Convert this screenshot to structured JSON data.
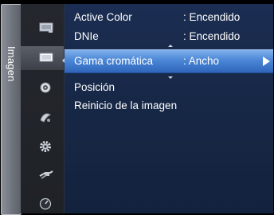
{
  "sidebar": {
    "title": "Imagen",
    "icons": [
      {
        "name": "picture-settings-icon",
        "active": false
      },
      {
        "name": "picture-icon",
        "active": true
      },
      {
        "name": "sound-icon",
        "active": false
      },
      {
        "name": "channel-icon",
        "active": false
      },
      {
        "name": "setup-gear-icon",
        "active": false
      },
      {
        "name": "input-plug-icon",
        "active": false
      },
      {
        "name": "support-dial-icon",
        "active": false
      }
    ]
  },
  "menu": {
    "items": [
      {
        "label": "Active Color",
        "value": ": Encendido"
      },
      {
        "label": "DNIe",
        "value": ": Encendido"
      },
      {
        "label": "Gama cromática",
        "value": ": Ancho",
        "selected": true,
        "has_submenu": true
      },
      {
        "label": "Posición",
        "value": ""
      },
      {
        "label": "Reinicio de la imagen",
        "value": ""
      }
    ]
  },
  "colors": {
    "panel": "#172847",
    "highlight": "#4b86d6",
    "text": "#ffffff",
    "rail": "#24272d",
    "tab": "#7a7f88"
  }
}
